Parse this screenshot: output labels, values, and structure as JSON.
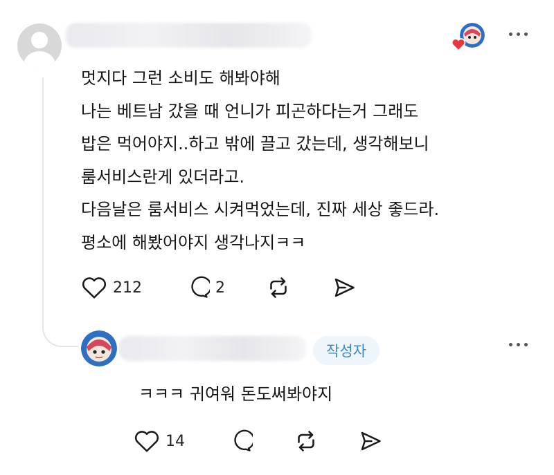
{
  "comment": {
    "lines": [
      "멋지다 그런 소비도 해봐야해",
      "나는 베트남 갔을 때 언니가 피곤하다는거 그래도",
      "밥은 먹어야지..하고 밖에 끌고 갔는데, 생각해보니",
      "룸서비스란게 있더라고.",
      "다음날은 룸서비스 시켜먹었는데, 진짜 세상 좋드라.",
      "평소에 해봤어야지 생각나지ㅋㅋ"
    ],
    "likes": "212",
    "replies": "2",
    "icons": [
      "heart-icon",
      "comment-icon",
      "repost-icon",
      "share-icon",
      "more-icon"
    ]
  },
  "reply": {
    "author_badge": "작성자",
    "text": "ㅋㅋㅋ 귀여워 돈도써봐야지",
    "likes": "14"
  },
  "colors": {
    "badge_bg": "#eef5fb",
    "badge_text": "#3f88c5",
    "heart_red": "#e8383d",
    "avatar_blue": "#2f6fc0"
  }
}
